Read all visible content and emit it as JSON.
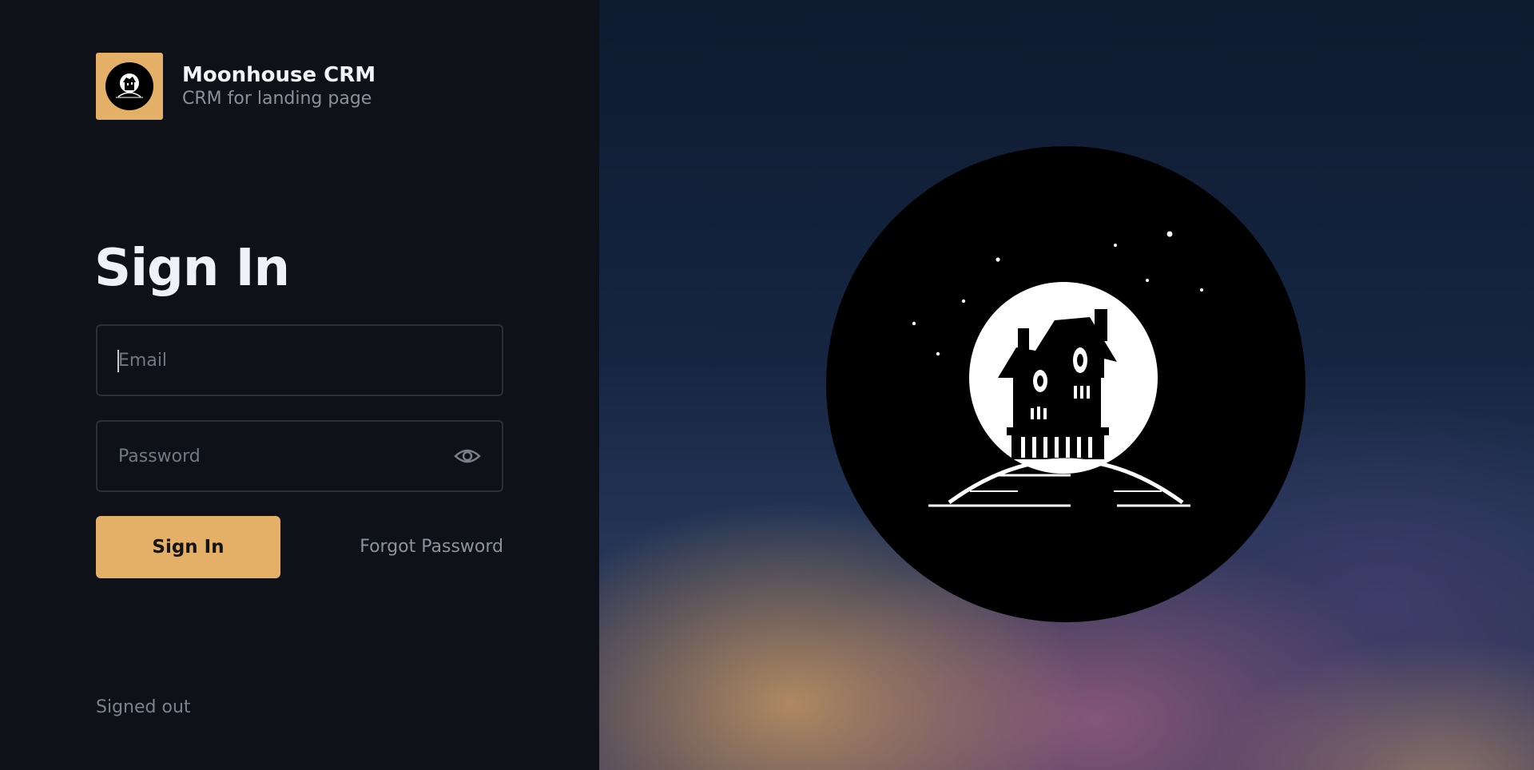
{
  "brand": {
    "name": "Moonhouse CRM",
    "tagline": "CRM for landing page",
    "logo_icon": "haunted-house-moon-icon"
  },
  "page": {
    "title": "Sign In"
  },
  "form": {
    "email": {
      "placeholder": "Email",
      "value": ""
    },
    "password": {
      "placeholder": "Password",
      "value": "",
      "toggle_icon": "eye-icon"
    },
    "submit_label": "Sign In",
    "forgot_label": "Forgot Password"
  },
  "status": {
    "text": "Signed out"
  },
  "colors": {
    "accent": "#e4b068",
    "panel_bg": "#0e1117",
    "heading": "#eef1f6",
    "muted": "#8a919b"
  }
}
